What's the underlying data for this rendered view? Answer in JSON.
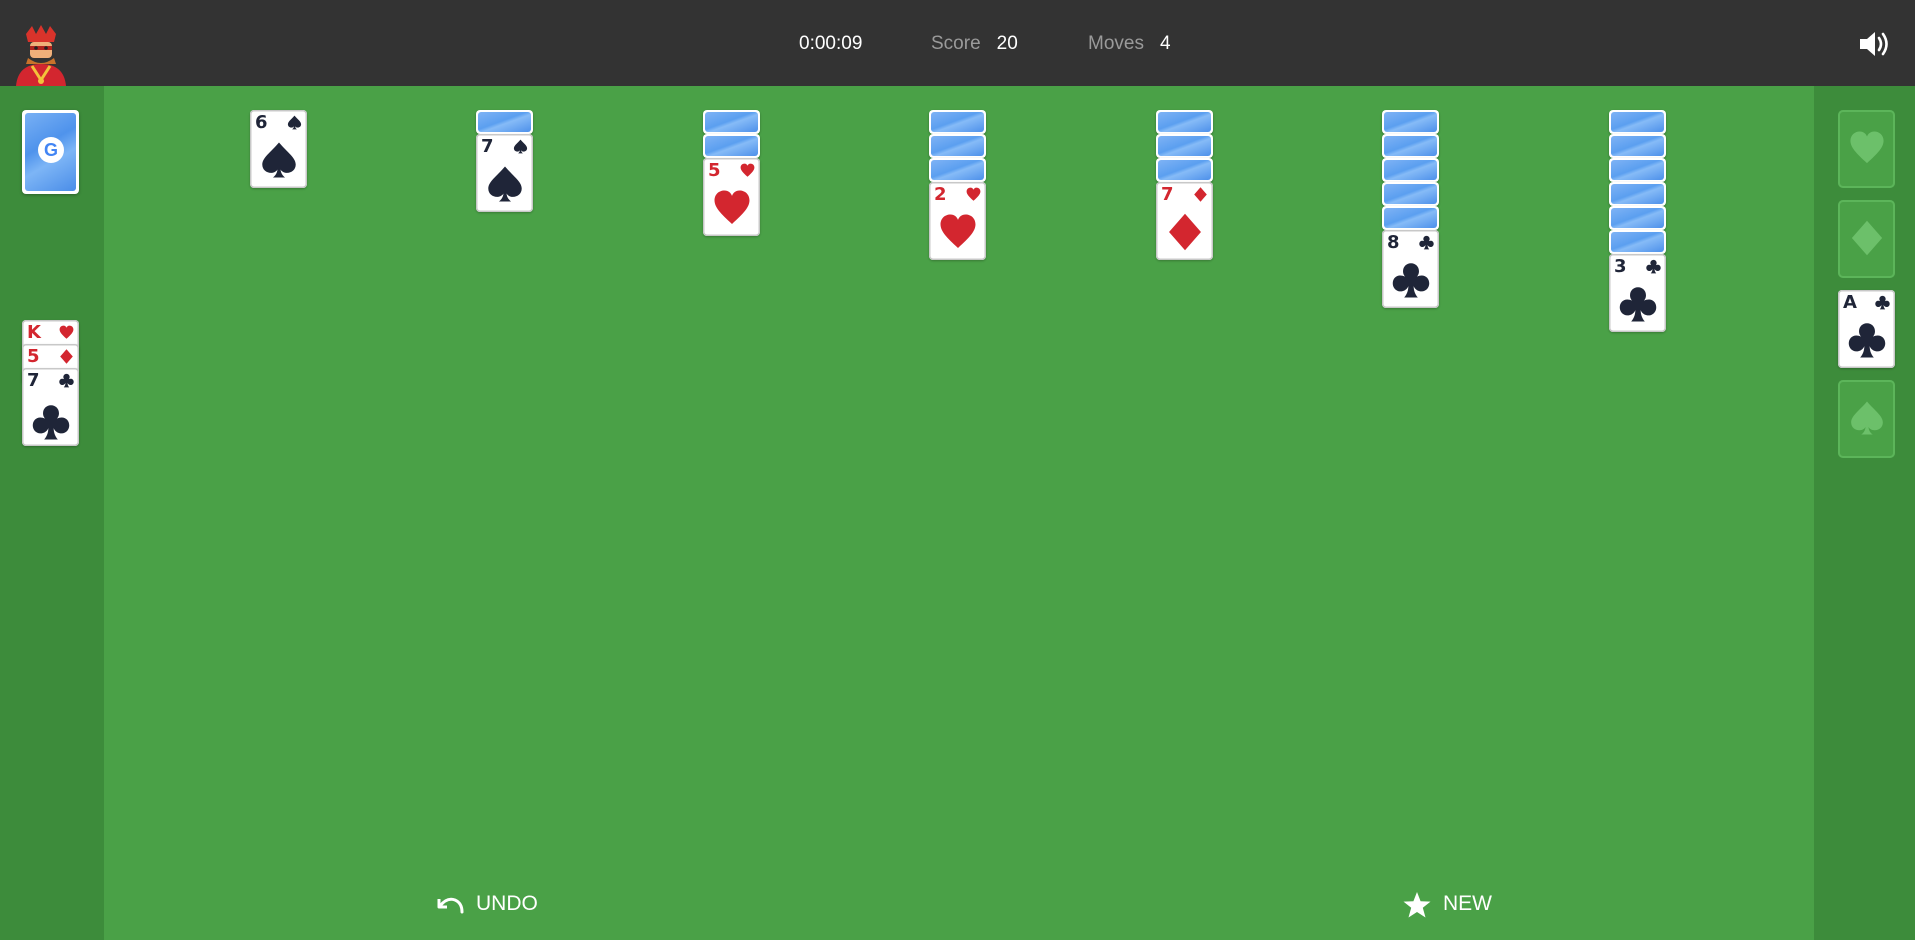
{
  "header": {
    "timer": "0:00:09",
    "score_label": "Score",
    "score_value": "20",
    "moves_label": "Moves",
    "moves_value": "4",
    "icons": {
      "avatar": "king-avatar-icon",
      "sound": "speaker-icon"
    }
  },
  "stock": {
    "icon": "google-logo-icon",
    "logo_text": "G"
  },
  "waste": [
    {
      "rank": "K",
      "suit": "heart"
    },
    {
      "rank": "5",
      "suit": "diamond"
    },
    {
      "rank": "7",
      "suit": "club"
    }
  ],
  "tableau": [
    {
      "face_down": 0,
      "face_up": [
        {
          "rank": "6",
          "suit": "spade"
        }
      ]
    },
    {
      "face_down": 1,
      "face_up": [
        {
          "rank": "7",
          "suit": "spade"
        }
      ]
    },
    {
      "face_down": 2,
      "face_up": [
        {
          "rank": "5",
          "suit": "heart"
        }
      ]
    },
    {
      "face_down": 3,
      "face_up": [
        {
          "rank": "2",
          "suit": "heart"
        }
      ]
    },
    {
      "face_down": 3,
      "face_up": [
        {
          "rank": "7",
          "suit": "diamond"
        }
      ]
    },
    {
      "face_down": 5,
      "face_up": [
        {
          "rank": "8",
          "suit": "club"
        }
      ]
    },
    {
      "face_down": 6,
      "face_up": [
        {
          "rank": "3",
          "suit": "club"
        }
      ]
    }
  ],
  "foundations": [
    {
      "suit": "heart",
      "card": null
    },
    {
      "suit": "diamond",
      "card": null
    },
    {
      "suit": "club",
      "card": {
        "rank": "A",
        "suit": "club"
      }
    },
    {
      "suit": "spade",
      "card": null
    }
  ],
  "controls": {
    "undo_label": "UNDO",
    "new_label": "NEW",
    "undo_icon": "undo-arrow-icon",
    "new_icon": "star-icon"
  },
  "colors": {
    "felt": "#4aa147",
    "side_panel": "#3d8c3b",
    "header": "#333333",
    "red_suit": "#d3262f",
    "black_suit": "#1f2538",
    "card_back": "#5b9ff0"
  }
}
